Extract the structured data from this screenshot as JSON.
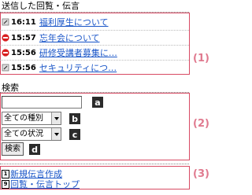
{
  "sent": {
    "title": "送信した回覧・伝言",
    "items": [
      {
        "icon": "clip-icon",
        "time": "16:11",
        "subject": "福利厚生について"
      },
      {
        "icon": "no-entry-icon",
        "time": "15:57",
        "subject": "忘年会について"
      },
      {
        "icon": "no-entry-icon",
        "time": "15:56",
        "subject": "研修受講者募集に…"
      },
      {
        "icon": "clip-icon",
        "time": "15:56",
        "subject": "セキュリティにつ…"
      }
    ],
    "tag": "(1)"
  },
  "search": {
    "title": "検索",
    "input_value": "",
    "type_select": "全ての種別",
    "status_select": "全ての状況",
    "button": "検索",
    "keys": {
      "a": "a",
      "b": "b",
      "c": "c",
      "d": "d"
    },
    "tag": "(2)"
  },
  "menu": {
    "items": [
      {
        "accesskey": "1",
        "label": "新規伝言作成"
      },
      {
        "accesskey": "9",
        "label": "回覧・伝言トップ"
      }
    ],
    "tag": "(3)"
  },
  "colors": {
    "link": "#1a56c8",
    "annotation": "#d84a63",
    "tag": "#e07a8f"
  }
}
